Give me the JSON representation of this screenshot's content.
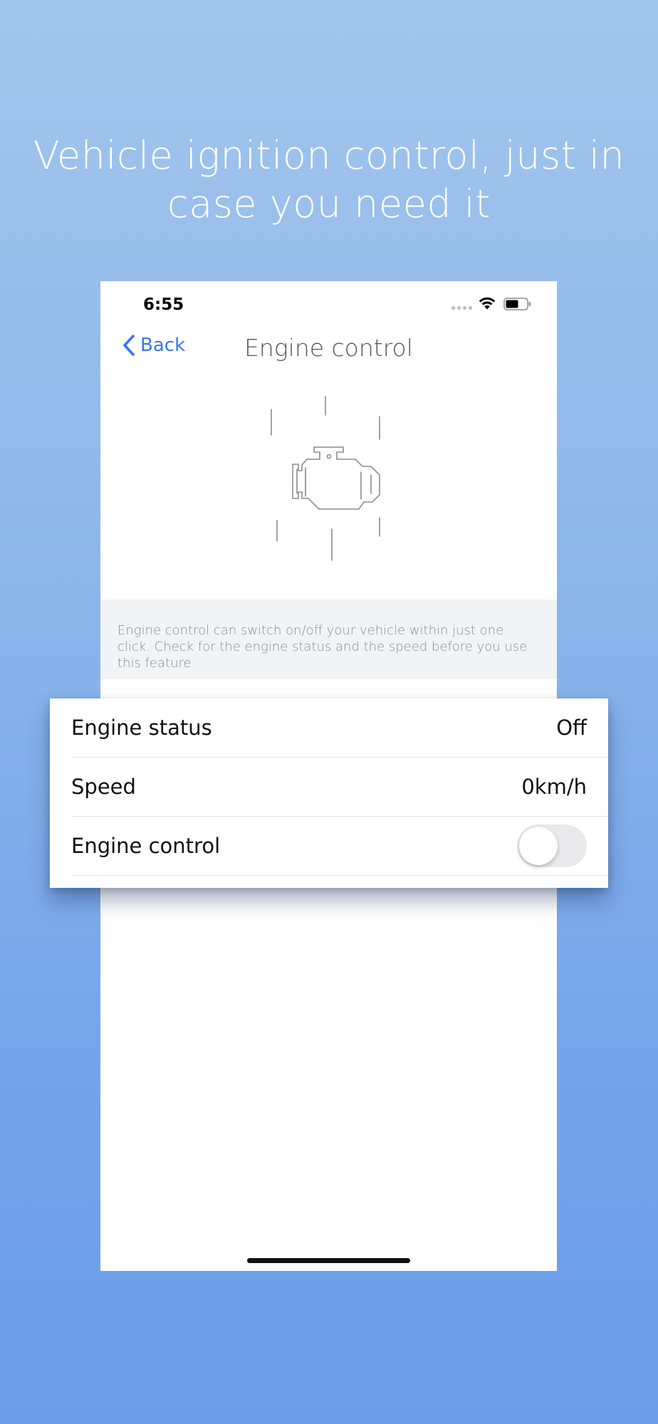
{
  "headline": "Vehicle ignition control, just in case you need it",
  "status_bar": {
    "time": "6:55",
    "wifi_icon": "wifi-icon",
    "battery_icon": "battery-icon"
  },
  "nav": {
    "back_label": "Back",
    "title": "Engine control"
  },
  "engine_icon": "engine-icon",
  "info_text": "Engine control can switch on/off your vehicle within just one click. Check for the engine status and the speed before you use this feature",
  "rows": [
    {
      "label": "Engine status",
      "value": "Off"
    },
    {
      "label": "Speed",
      "value": "0km/h"
    },
    {
      "label": "Engine control",
      "toggle_on": false
    }
  ],
  "colors": {
    "accent": "#3478f6",
    "background_top": "#a2c6ec",
    "background_bottom": "#6b9dea"
  }
}
